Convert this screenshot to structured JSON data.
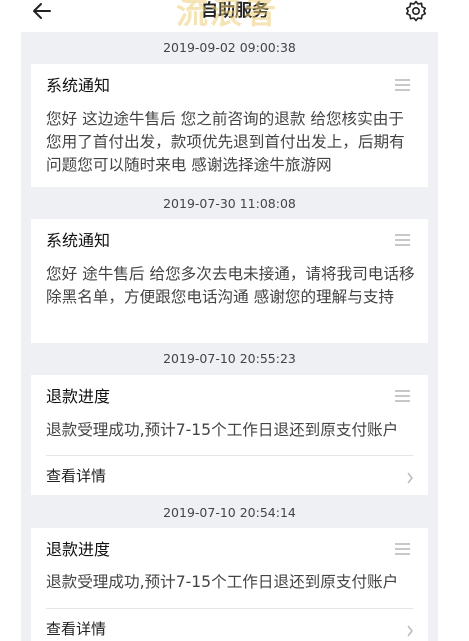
{
  "header": {
    "title": "自助服务",
    "watermark": "流浪者",
    "back_icon": "back-arrow-icon",
    "settings_icon": "gear-icon"
  },
  "messages": [
    {
      "time": "2019-09-02 09:00:38",
      "title": "系统通知",
      "body": "您好 这边途牛售后  您之前咨询的退款 给您核实由于您用了首付出发，款项优先退到首付出发上，后期有问题您可以随时来电  感谢选择途牛旅游网"
    },
    {
      "time": "2019-07-30 11:08:08",
      "title": "系统通知",
      "body": "您好 途牛售后 给您多次去电未接通，请将我司电话移除黑名单，方便跟您电话沟通 感谢您的理解与支持"
    },
    {
      "time": "2019-07-10 20:55:23",
      "title": "退款进度",
      "body": "退款受理成功,预计7-15个工作日退还到原支付账户",
      "link": "查看详情"
    },
    {
      "time": "2019-07-10 20:54:14",
      "title": "退款进度",
      "body": "退款受理成功,预计7-15个工作日退还到原支付账户",
      "link": "查看详情"
    }
  ],
  "colors": {
    "feed_background": "#eef0f4",
    "card_background": "#ffffff",
    "body_text": "#444444"
  }
}
